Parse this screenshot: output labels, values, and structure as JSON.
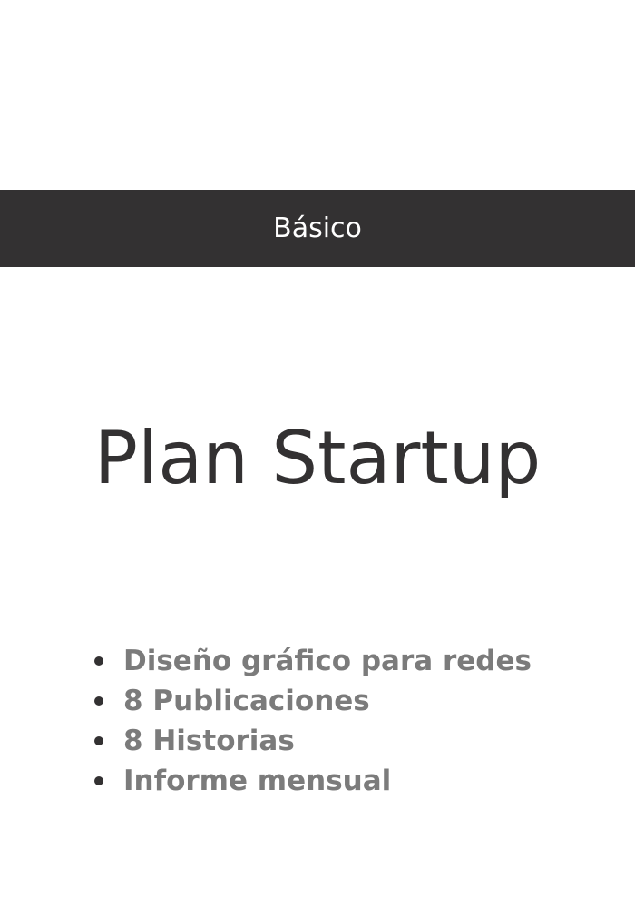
{
  "tier": {
    "label": "Básico"
  },
  "plan": {
    "title": "Plan Startup"
  },
  "features": [
    "Diseño gráfico para redes",
    "8 Publicaciones",
    "8 Historias",
    "Informe mensual"
  ],
  "colors": {
    "banner": "#333132",
    "title": "#333132",
    "feature_text": "#7b7b7b",
    "bullet": "#333132",
    "background": "#ffffff"
  }
}
